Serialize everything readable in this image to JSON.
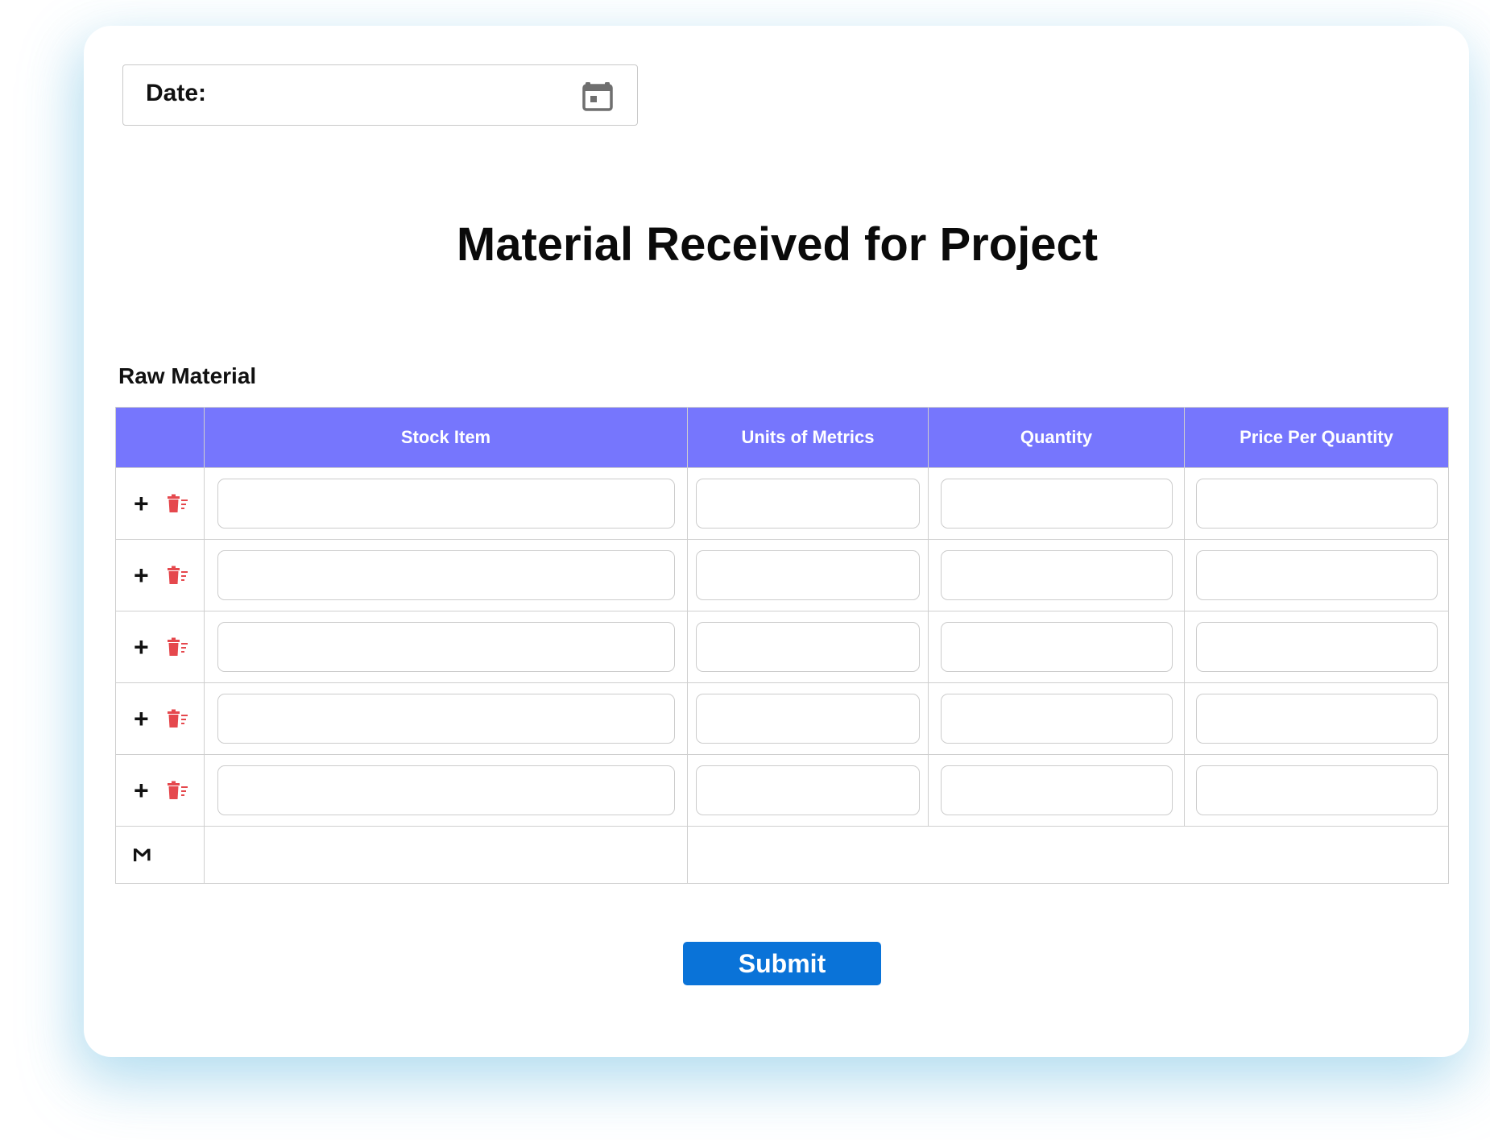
{
  "date": {
    "label": "Date:",
    "value": ""
  },
  "title": "Material Received for Project",
  "section": {
    "label": "Raw Material"
  },
  "table": {
    "columns": [
      "",
      "Stock Item",
      "Units of Metrics",
      "Quantity",
      "Price Per Quantity"
    ],
    "rows": [
      {
        "stock_item": "",
        "units": "",
        "quantity": "",
        "price": ""
      },
      {
        "stock_item": "",
        "units": "",
        "quantity": "",
        "price": ""
      },
      {
        "stock_item": "",
        "units": "",
        "quantity": "",
        "price": ""
      },
      {
        "stock_item": "",
        "units": "",
        "quantity": "",
        "price": ""
      },
      {
        "stock_item": "",
        "units": "",
        "quantity": "",
        "price": ""
      }
    ],
    "add_row_label": "+",
    "delete_icon": "trash-list-icon",
    "sum_symbol": "Σ"
  },
  "submit_label": "Submit",
  "colors": {
    "header": "#7676fd",
    "delete": "#e5484d",
    "submit": "#0a73d8"
  }
}
